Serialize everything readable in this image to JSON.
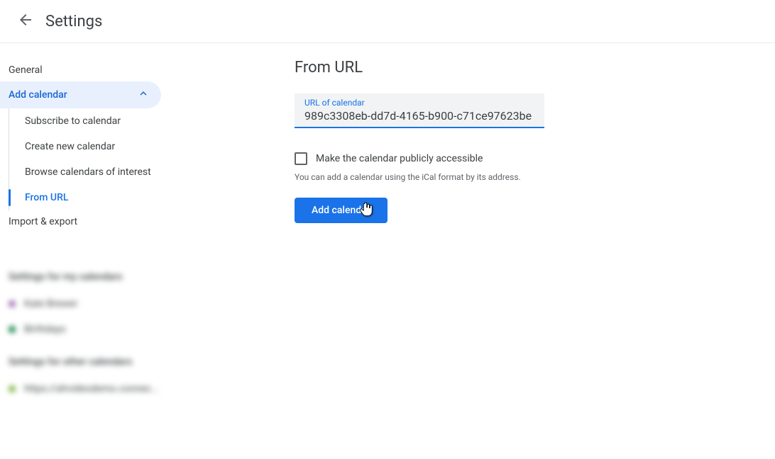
{
  "header": {
    "title": "Settings"
  },
  "sidebar": {
    "general_label": "General",
    "add_calendar_label": "Add calendar",
    "sub_items": [
      "Subscribe to calendar",
      "Create new calendar",
      "Browse calendars of interest",
      "From URL"
    ],
    "import_export_label": "Import & export",
    "section_my": "Settings for my calendars",
    "my_calendars": [
      "Kate Brewer",
      "Birthdays"
    ],
    "section_other": "Settings for other calendars",
    "other_calendars": [
      "https://ahvideodemo.connec..."
    ]
  },
  "main": {
    "title": "From URL",
    "url_label": "URL of calendar",
    "url_value": "989c3308eb-dd7d-4165-b900-c71ce97623be",
    "checkbox_label": "Make the calendar publicly accessible",
    "helper": "You can add a calendar using the iCal format by its address.",
    "button_label": "Add calendar"
  },
  "colors": {
    "purple": "#9e69af",
    "teal": "#0b8043",
    "green": "#7cb342"
  }
}
